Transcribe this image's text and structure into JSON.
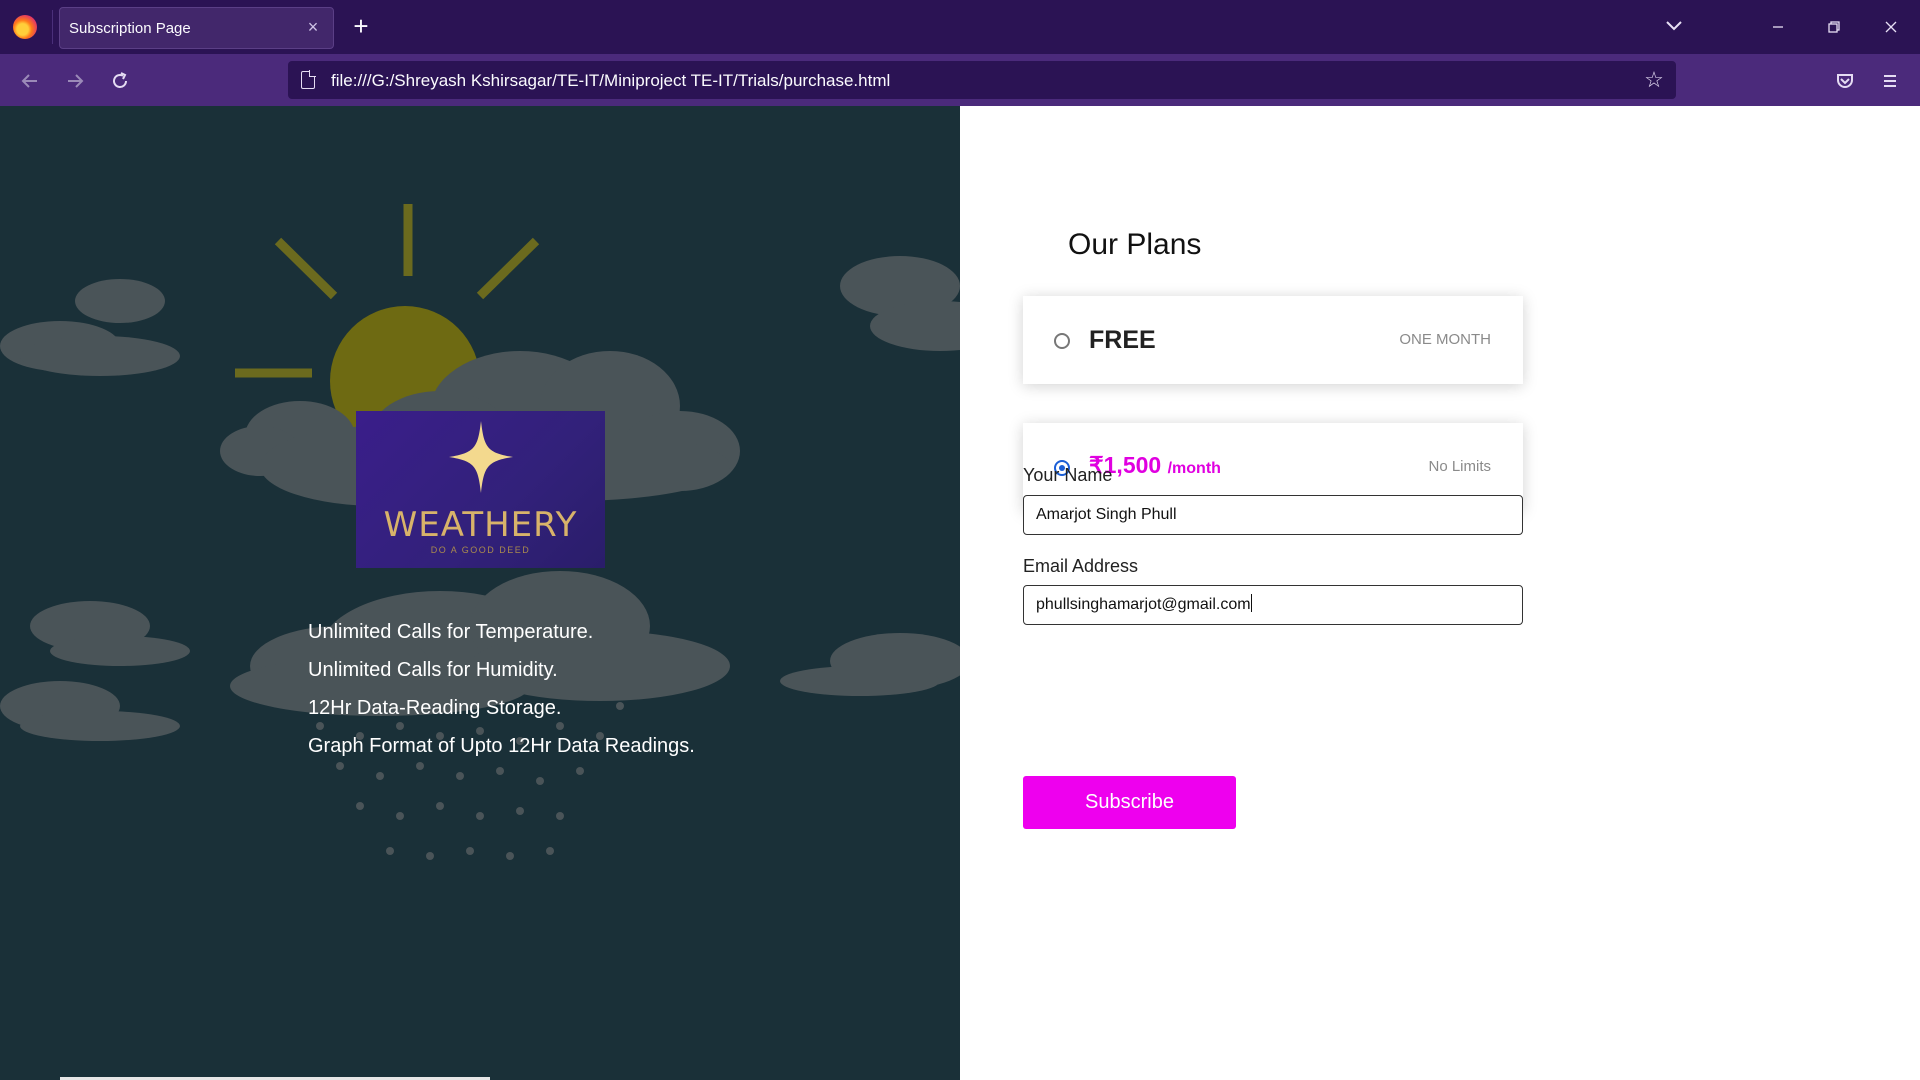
{
  "browser": {
    "tab_title": "Subscription Page",
    "tab_close_icon": "×",
    "new_tab_icon": "+",
    "url": "file:///G:/Shreyash Kshirsagar/TE-IT/Miniproject TE-IT/Trials/purchase.html",
    "accent": "#2b1354",
    "toolbar_color": "#4b2a7b"
  },
  "hero": {
    "logo": {
      "word": "WEATHERY",
      "tagline": "DO A GOOD DEED"
    },
    "features": [
      "Unlimited Calls for Temperature.",
      "Unlimited Calls for Humidity.",
      "12Hr Data-Reading Storage.",
      "Graph Format of Upto 12Hr Data Readings."
    ],
    "background_color": "#1a3038"
  },
  "plans": {
    "title": "Our Plans",
    "items": [
      {
        "name": "FREE",
        "note": "ONE MONTH",
        "selected": false
      },
      {
        "price": "₹1,500",
        "per": "/month",
        "note": "No Limits",
        "selected": true
      }
    ]
  },
  "form": {
    "name_label": "Your Name",
    "name_value": "Amarjot Singh Phull",
    "email_label": "Email Address",
    "email_value": "phullsinghamarjot@gmail.com",
    "submit_label": "Subscribe",
    "submit_color": "#ee00ee"
  }
}
